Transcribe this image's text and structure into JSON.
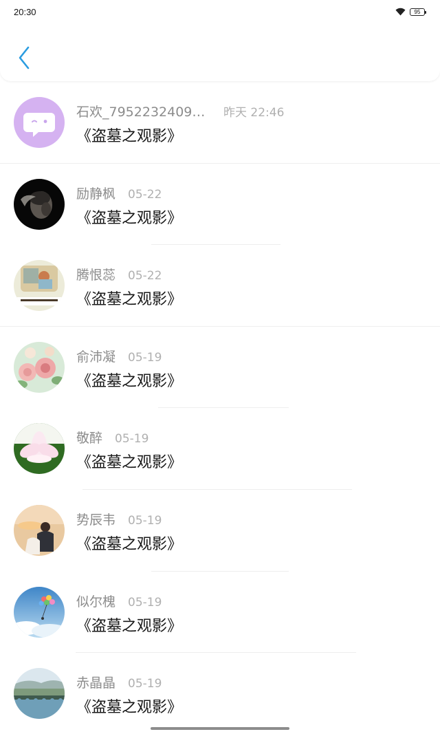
{
  "status_bar": {
    "time": "20:30",
    "battery": "95"
  },
  "header": {
    "back_icon": "chevron-left-icon",
    "accent_color": "#2a9ce0"
  },
  "items": [
    {
      "name": "石欢_79522324091...",
      "time": "昨天 22:46",
      "title": "《盗墓之观影》",
      "avatar": "chat-bubble"
    },
    {
      "name": "励静枫",
      "time": "05-22",
      "title": "《盗墓之观影》",
      "avatar": "dark-portrait"
    },
    {
      "name": "腾恨蕊",
      "time": "05-22",
      "title": "《盗墓之观影》",
      "avatar": "painting"
    },
    {
      "name": "俞沛凝",
      "time": "05-19",
      "title": "《盗墓之观影》",
      "avatar": "roses"
    },
    {
      "name": "敬醉",
      "time": "05-19",
      "title": "《盗墓之观影》",
      "avatar": "lotus"
    },
    {
      "name": "势辰韦",
      "time": "05-19",
      "title": "《盗墓之观影》",
      "avatar": "couple-sunset"
    },
    {
      "name": "似尔槐",
      "time": "05-19",
      "title": "《盗墓之观影》",
      "avatar": "balloons-sky"
    },
    {
      "name": "赤晶晶",
      "time": "05-19",
      "title": "《盗墓之观影》",
      "avatar": "bridge-lake"
    }
  ]
}
